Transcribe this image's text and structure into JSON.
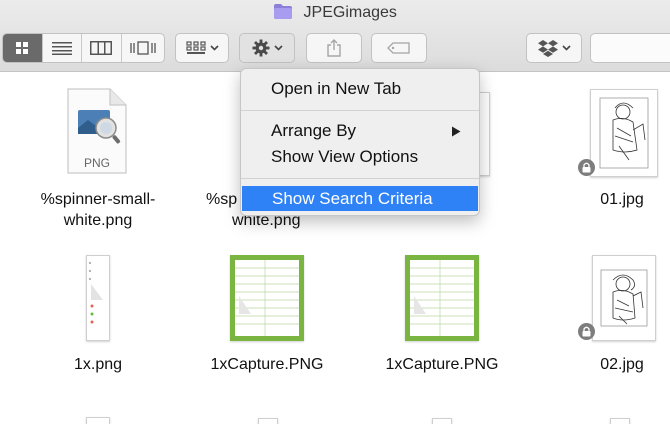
{
  "window": {
    "title": "JPEGimages"
  },
  "toolbar": {
    "view_modes": [
      "icon-view",
      "list-view",
      "column-view",
      "cover-flow-view"
    ],
    "active_view": "icon-view"
  },
  "menu": {
    "items": [
      {
        "label": "Open in New Tab"
      },
      {
        "label": "Arrange By",
        "has_submenu": true
      },
      {
        "label": "Show View Options"
      },
      {
        "label": "Show Search Criteria",
        "highlighted": true
      }
    ]
  },
  "files": [
    {
      "line1": "%spinner-small-",
      "line2": "white.png",
      "badge": "PNG"
    },
    {
      "line1": "%sp",
      "line2": "white.png"
    },
    {
      "line1": "01.jpg",
      "line2": ""
    },
    {
      "line1": "1x.png",
      "line2": ""
    },
    {
      "line1": "1xCapture.PNG",
      "line2": ""
    },
    {
      "line1": "1xCapture.PNG",
      "line2": ""
    },
    {
      "line1": "02.jpg",
      "line2": ""
    }
  ],
  "colors": {
    "highlight": "#2f82f5",
    "accent_green": "#7ab542",
    "folder": "#8b7fd8"
  }
}
